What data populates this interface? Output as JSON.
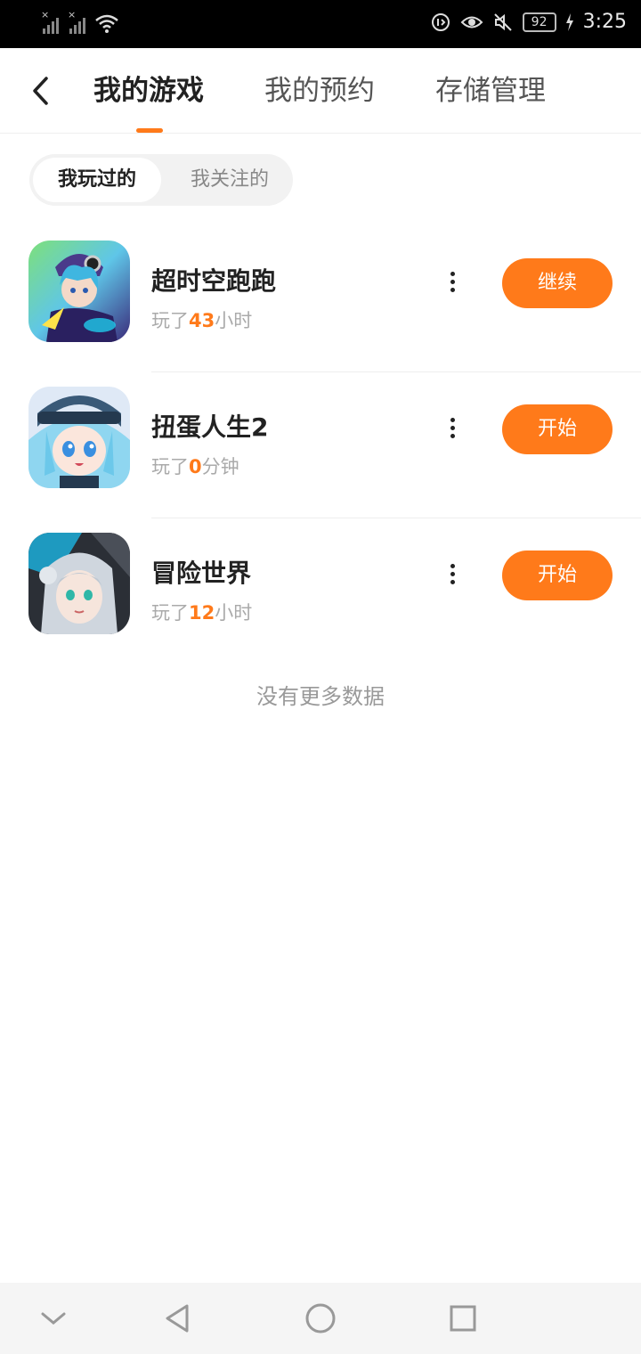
{
  "status_bar": {
    "battery": "92",
    "time": "3:25"
  },
  "header": {
    "tabs": [
      {
        "label": "我的游戏",
        "active": true
      },
      {
        "label": "我的预约",
        "active": false
      },
      {
        "label": "存储管理",
        "active": false
      }
    ]
  },
  "segment": {
    "items": [
      {
        "label": "我玩过的",
        "active": true
      },
      {
        "label": "我关注的",
        "active": false
      }
    ]
  },
  "games": [
    {
      "title": "超时空跑跑",
      "played_prefix": "玩了",
      "played_value": "43",
      "played_unit": "小时",
      "action": "继续"
    },
    {
      "title": "扭蛋人生2",
      "played_prefix": "玩了",
      "played_value": "0",
      "played_unit": "分钟",
      "action": "开始"
    },
    {
      "title": "冒险世界",
      "played_prefix": "玩了",
      "played_value": "12",
      "played_unit": "小时",
      "action": "开始"
    }
  ],
  "footer_text": "没有更多数据",
  "colors": {
    "accent": "#ff7a1a",
    "title_text": "#222222",
    "muted_text": "#aaaaaa"
  }
}
